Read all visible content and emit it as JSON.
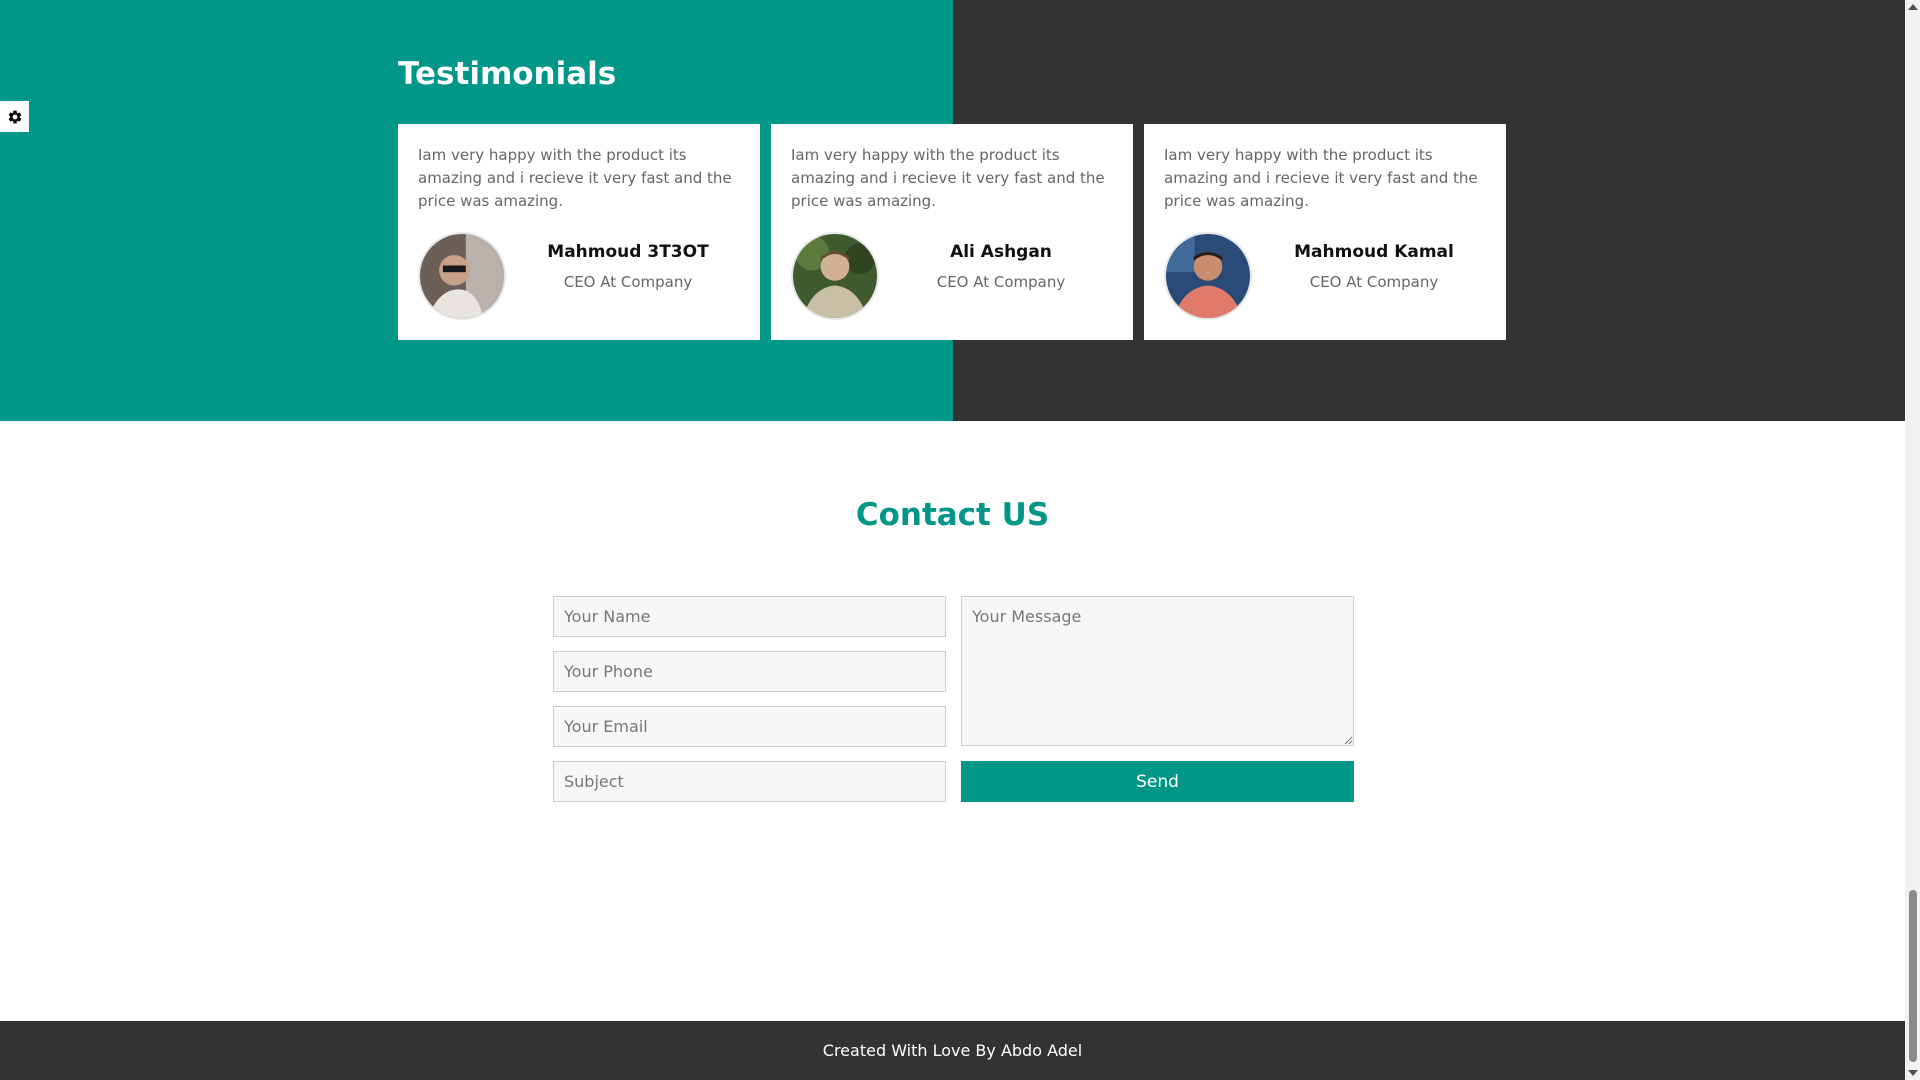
{
  "testimonials": {
    "title": "Testimonials",
    "items": [
      {
        "text": "Iam very happy with the product its amazing and i recieve it very fast and the price was amazing.",
        "name": "Mahmoud 3T3OT",
        "role": "CEO At Company"
      },
      {
        "text": "Iam very happy with the product its amazing and i recieve it very fast and the price was amazing.",
        "name": "Ali Ashgan",
        "role": "CEO At Company"
      },
      {
        "text": "Iam very happy with the product its amazing and i recieve it very fast and the price was amazing.",
        "name": "Mahmoud Kamal",
        "role": "CEO At Company"
      }
    ]
  },
  "contact": {
    "title": "Contact US",
    "name_placeholder": "Your Name",
    "phone_placeholder": "Your Phone",
    "email_placeholder": "Your Email",
    "subject_placeholder": "Subject",
    "message_placeholder": "Your Message",
    "send_label": "Send"
  },
  "footer": {
    "text": "Created With Love By Abdo Adel"
  },
  "settings": {
    "icon": "gear-icon"
  },
  "colors": {
    "accent": "#009688",
    "dark": "#333333"
  }
}
